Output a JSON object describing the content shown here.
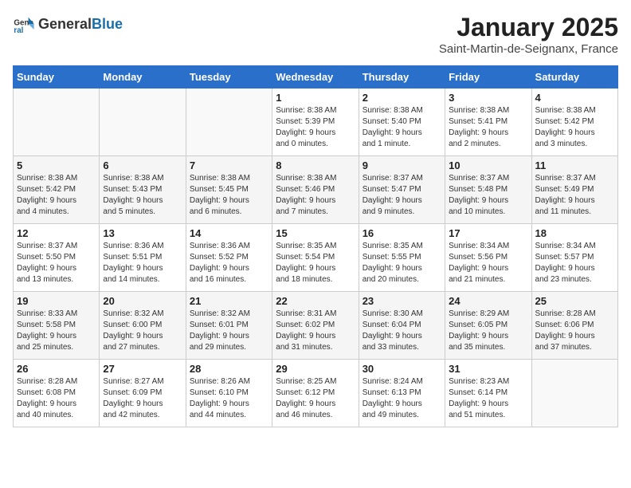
{
  "logo": {
    "general": "General",
    "blue": "Blue"
  },
  "title": "January 2025",
  "subtitle": "Saint-Martin-de-Seignanx, France",
  "days_of_week": [
    "Sunday",
    "Monday",
    "Tuesday",
    "Wednesday",
    "Thursday",
    "Friday",
    "Saturday"
  ],
  "weeks": [
    [
      {
        "day": "",
        "info": ""
      },
      {
        "day": "",
        "info": ""
      },
      {
        "day": "",
        "info": ""
      },
      {
        "day": "1",
        "info": "Sunrise: 8:38 AM\nSunset: 5:39 PM\nDaylight: 9 hours\nand 0 minutes."
      },
      {
        "day": "2",
        "info": "Sunrise: 8:38 AM\nSunset: 5:40 PM\nDaylight: 9 hours\nand 1 minute."
      },
      {
        "day": "3",
        "info": "Sunrise: 8:38 AM\nSunset: 5:41 PM\nDaylight: 9 hours\nand 2 minutes."
      },
      {
        "day": "4",
        "info": "Sunrise: 8:38 AM\nSunset: 5:42 PM\nDaylight: 9 hours\nand 3 minutes."
      }
    ],
    [
      {
        "day": "5",
        "info": "Sunrise: 8:38 AM\nSunset: 5:42 PM\nDaylight: 9 hours\nand 4 minutes."
      },
      {
        "day": "6",
        "info": "Sunrise: 8:38 AM\nSunset: 5:43 PM\nDaylight: 9 hours\nand 5 minutes."
      },
      {
        "day": "7",
        "info": "Sunrise: 8:38 AM\nSunset: 5:45 PM\nDaylight: 9 hours\nand 6 minutes."
      },
      {
        "day": "8",
        "info": "Sunrise: 8:38 AM\nSunset: 5:46 PM\nDaylight: 9 hours\nand 7 minutes."
      },
      {
        "day": "9",
        "info": "Sunrise: 8:37 AM\nSunset: 5:47 PM\nDaylight: 9 hours\nand 9 minutes."
      },
      {
        "day": "10",
        "info": "Sunrise: 8:37 AM\nSunset: 5:48 PM\nDaylight: 9 hours\nand 10 minutes."
      },
      {
        "day": "11",
        "info": "Sunrise: 8:37 AM\nSunset: 5:49 PM\nDaylight: 9 hours\nand 11 minutes."
      }
    ],
    [
      {
        "day": "12",
        "info": "Sunrise: 8:37 AM\nSunset: 5:50 PM\nDaylight: 9 hours\nand 13 minutes."
      },
      {
        "day": "13",
        "info": "Sunrise: 8:36 AM\nSunset: 5:51 PM\nDaylight: 9 hours\nand 14 minutes."
      },
      {
        "day": "14",
        "info": "Sunrise: 8:36 AM\nSunset: 5:52 PM\nDaylight: 9 hours\nand 16 minutes."
      },
      {
        "day": "15",
        "info": "Sunrise: 8:35 AM\nSunset: 5:54 PM\nDaylight: 9 hours\nand 18 minutes."
      },
      {
        "day": "16",
        "info": "Sunrise: 8:35 AM\nSunset: 5:55 PM\nDaylight: 9 hours\nand 20 minutes."
      },
      {
        "day": "17",
        "info": "Sunrise: 8:34 AM\nSunset: 5:56 PM\nDaylight: 9 hours\nand 21 minutes."
      },
      {
        "day": "18",
        "info": "Sunrise: 8:34 AM\nSunset: 5:57 PM\nDaylight: 9 hours\nand 23 minutes."
      }
    ],
    [
      {
        "day": "19",
        "info": "Sunrise: 8:33 AM\nSunset: 5:58 PM\nDaylight: 9 hours\nand 25 minutes."
      },
      {
        "day": "20",
        "info": "Sunrise: 8:32 AM\nSunset: 6:00 PM\nDaylight: 9 hours\nand 27 minutes."
      },
      {
        "day": "21",
        "info": "Sunrise: 8:32 AM\nSunset: 6:01 PM\nDaylight: 9 hours\nand 29 minutes."
      },
      {
        "day": "22",
        "info": "Sunrise: 8:31 AM\nSunset: 6:02 PM\nDaylight: 9 hours\nand 31 minutes."
      },
      {
        "day": "23",
        "info": "Sunrise: 8:30 AM\nSunset: 6:04 PM\nDaylight: 9 hours\nand 33 minutes."
      },
      {
        "day": "24",
        "info": "Sunrise: 8:29 AM\nSunset: 6:05 PM\nDaylight: 9 hours\nand 35 minutes."
      },
      {
        "day": "25",
        "info": "Sunrise: 8:28 AM\nSunset: 6:06 PM\nDaylight: 9 hours\nand 37 minutes."
      }
    ],
    [
      {
        "day": "26",
        "info": "Sunrise: 8:28 AM\nSunset: 6:08 PM\nDaylight: 9 hours\nand 40 minutes."
      },
      {
        "day": "27",
        "info": "Sunrise: 8:27 AM\nSunset: 6:09 PM\nDaylight: 9 hours\nand 42 minutes."
      },
      {
        "day": "28",
        "info": "Sunrise: 8:26 AM\nSunset: 6:10 PM\nDaylight: 9 hours\nand 44 minutes."
      },
      {
        "day": "29",
        "info": "Sunrise: 8:25 AM\nSunset: 6:12 PM\nDaylight: 9 hours\nand 46 minutes."
      },
      {
        "day": "30",
        "info": "Sunrise: 8:24 AM\nSunset: 6:13 PM\nDaylight: 9 hours\nand 49 minutes."
      },
      {
        "day": "31",
        "info": "Sunrise: 8:23 AM\nSunset: 6:14 PM\nDaylight: 9 hours\nand 51 minutes."
      },
      {
        "day": "",
        "info": ""
      }
    ]
  ]
}
